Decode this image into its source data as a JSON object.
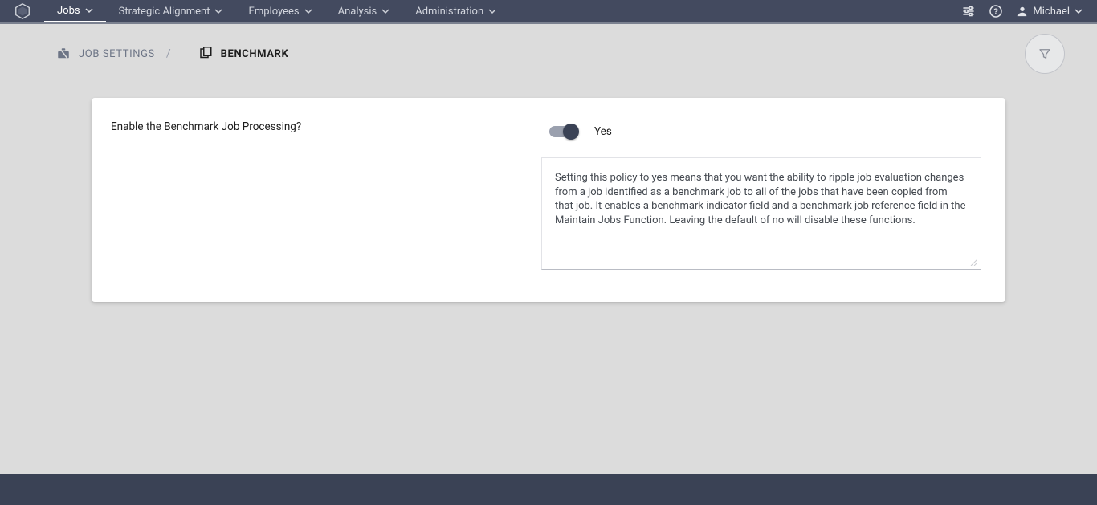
{
  "nav": {
    "items": [
      {
        "label": "Jobs",
        "active": true
      },
      {
        "label": "Strategic Alignment",
        "active": false
      },
      {
        "label": "Employees",
        "active": false
      },
      {
        "label": "Analysis",
        "active": false
      },
      {
        "label": "Administration",
        "active": false
      }
    ]
  },
  "user": {
    "name": "Michael"
  },
  "breadcrumb": {
    "root": "JOB SETTINGS",
    "current": "BENCHMARK"
  },
  "card": {
    "question": "Enable the Benchmark Job Processing?",
    "toggle_value_label": "Yes",
    "toggle_on": true,
    "description": "Setting this policy to yes means that you want the ability to ripple job evaluation changes from a job identified as a benchmark job to all of the jobs that have been copied from that job. It enables a benchmark indicator field and a benchmark job reference field in the Maintain Jobs Function. Leaving the default of no will disable these functions."
  },
  "colors": {
    "nav_bg": "#434a5f",
    "page_bg": "#dcdcdc",
    "card_bg": "#ffffff",
    "footer_bg": "#3a4255",
    "toggle_knob": "#3a4255"
  }
}
